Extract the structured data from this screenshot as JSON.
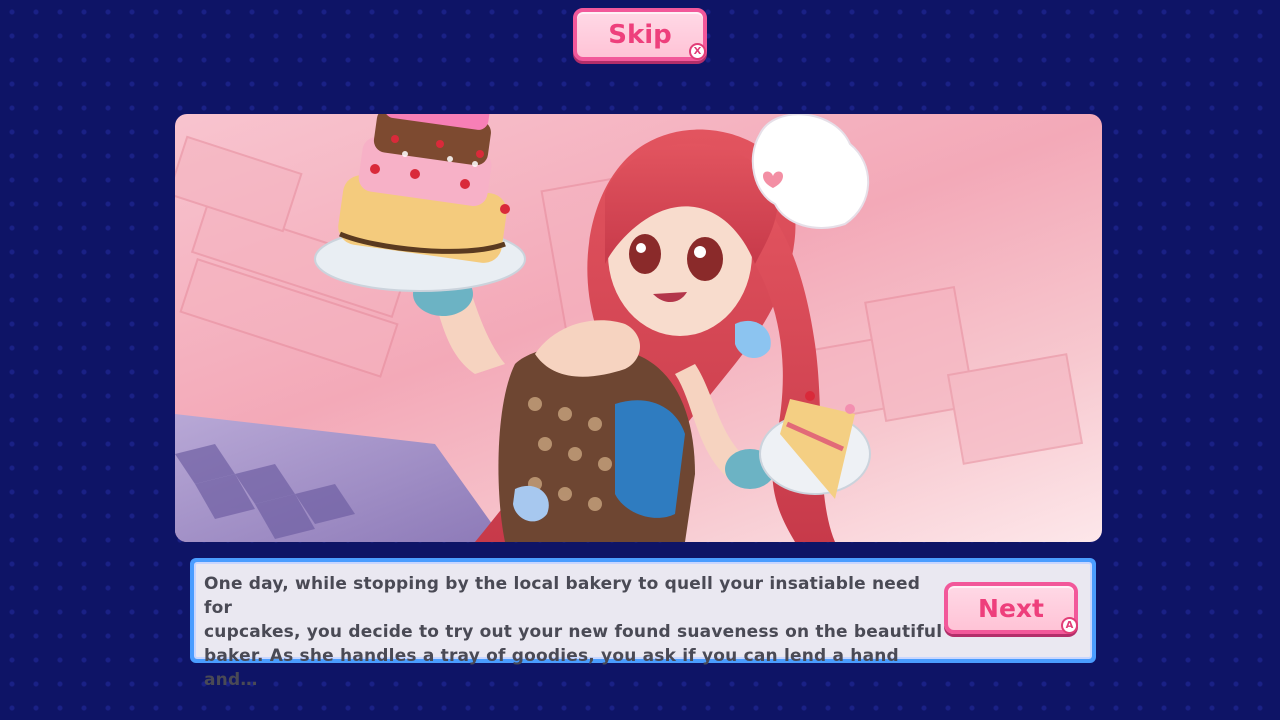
{
  "skip_button": {
    "label": "Skip",
    "key_hint": "X"
  },
  "next_button": {
    "label": "Next",
    "key_hint": "A"
  },
  "dialog": {
    "text": "One day, while stopping by the local bakery to quell your insatiable need for\ncupcakes, you decide to try out your new found suaveness on the beautiful\nbaker. As she handles a tray of goodies, you ask if you can lend a hand and…"
  },
  "colors": {
    "background": "#0e1466",
    "button_border": "#f2589a",
    "button_fill": "#ffc3d6",
    "button_text": "#ee3f7c",
    "dialog_frame": "#4a9dff",
    "dialog_fill": "#eae8f1"
  }
}
